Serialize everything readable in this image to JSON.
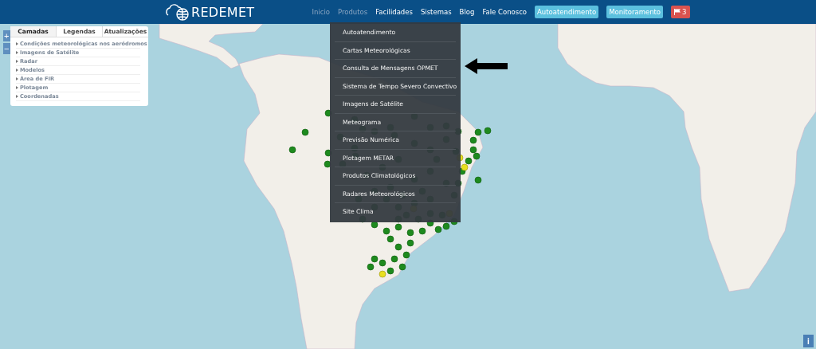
{
  "header": {
    "logo": "REDEMET",
    "nav": [
      {
        "label": "Inicio",
        "kind": "link",
        "dimmed": true
      },
      {
        "label": "Produtos",
        "kind": "link",
        "dimmed": true
      },
      {
        "label": "Facilidades",
        "kind": "link",
        "dimmed": false
      },
      {
        "label": "Sistemas",
        "kind": "link",
        "dimmed": false
      },
      {
        "label": "Blog",
        "kind": "link",
        "dimmed": false
      },
      {
        "label": "Fale Conosco",
        "kind": "link",
        "dimmed": false
      },
      {
        "label": "Autoatendimento",
        "kind": "button",
        "dimmed": false
      },
      {
        "label": "Monitoramento",
        "kind": "button",
        "dimmed": false
      },
      {
        "label": "3",
        "kind": "alert",
        "dimmed": false
      }
    ]
  },
  "dropdown": {
    "items": [
      "Autoatendimento",
      "Cartas Meteorológicas",
      "Consulta de Mensagens OPMET",
      "Sistema de Tempo Severo Convectivo",
      "Imagens de Satélite",
      "Meteograma",
      "Previsão Numérica",
      "Plotagem METAR",
      "Produtos Climatológicos",
      "Radares Meteorológicos",
      "Site Clima"
    ]
  },
  "layers_panel": {
    "tabs": [
      {
        "label": "Camadas",
        "selected": true
      },
      {
        "label": "Legendas",
        "selected": false
      },
      {
        "label": "Atualizações",
        "selected": false
      }
    ],
    "items": [
      "Condições meteorológicas nos aeródromos",
      "Imagens de Satélite",
      "Radar",
      "Modelos",
      "Área de FIR",
      "Plotagem",
      "Coordenadas"
    ]
  },
  "zoom_controls": [
    "+",
    "−"
  ],
  "info_button": "i"
}
